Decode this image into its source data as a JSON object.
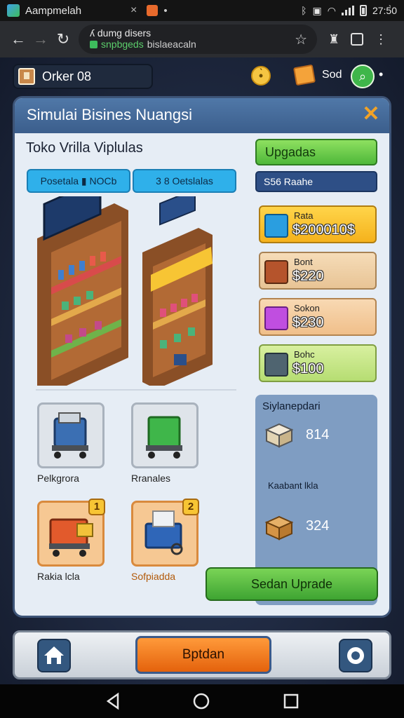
{
  "status_bar": {
    "tab_title": "Aampmelah",
    "tab_close": "×",
    "tab_extra": "•",
    "time": "27:5̀0",
    "icons": [
      "bluetooth-icon",
      "nfc-icon",
      "wifi-icon",
      "signal-icon",
      "battery-icon"
    ]
  },
  "browser": {
    "url_line1": "ʎ dumg disers",
    "url_line2_prefix": "snpbgeds",
    "url_line2_suffix": "bislaeacaln",
    "icons": [
      "back-arrow-icon",
      "forward-arrow-icon",
      "reload-icon",
      "star-icon",
      "extension-icon",
      "tabs-icon",
      "menu-dots-icon"
    ]
  },
  "hud": {
    "order_label": "Orker 08",
    "user_label": "Sod"
  },
  "panel": {
    "title": "Simulai Bisines Nuangsi",
    "shop_name": "Toko Vrilla Viplulas",
    "pill_a": "Posetala ▮ NOCb",
    "pill_b": "3 8 Oetslalas",
    "upgrades_button": "Upgadas",
    "stat_bar": "S56 Raahe",
    "price_cards": [
      {
        "label": "Rata",
        "value": "$200010$",
        "icon": "box-icon"
      },
      {
        "label": "Bont",
        "value": "$220",
        "icon": "basket-icon"
      },
      {
        "label": "Sokon",
        "value": "$230",
        "icon": "cart-icon"
      },
      {
        "label": "Bohc",
        "value": "$100",
        "icon": "trash-cart-icon"
      }
    ],
    "tiles": [
      {
        "label": "Pelkgrora",
        "badge": "",
        "icon": "register-cart-icon"
      },
      {
        "label": "Rranales",
        "badge": "",
        "icon": "green-cart-icon"
      },
      {
        "label": "Rakia lcla",
        "badge": "1",
        "icon": "orange-cart-icon"
      },
      {
        "label": "Sofpiadda",
        "badge": "2",
        "icon": "blue-cart-icon"
      }
    ],
    "sidebar": {
      "title": "Siylanepdari",
      "row1_value": "814",
      "row2_text": "Kaabant lkla",
      "row3_value": "324"
    },
    "select_button": "Sedan Uprade"
  },
  "bottom_bar": {
    "primary_button": "Bptdan"
  },
  "colors": {
    "panel_header": "#3b5e8c",
    "accent_green": "#4fb83a",
    "accent_orange": "#e4620c",
    "accent_blue": "#2fb0ea"
  }
}
